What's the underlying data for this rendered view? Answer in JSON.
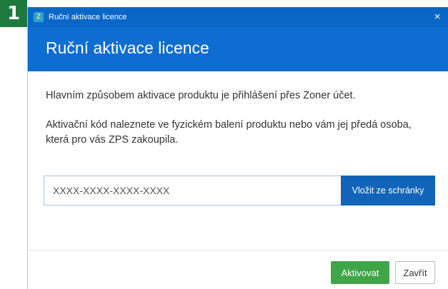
{
  "step_badge": "1",
  "window": {
    "title": "Ruční aktivace licence",
    "app_icon": "zoner-app-icon",
    "close_symbol": "×"
  },
  "header": {
    "title": "Ruční aktivace licence"
  },
  "content": {
    "paragraph1": "Hlavním způsobem aktivace produktu je přihlášení přes Zoner účet.",
    "paragraph2": "Aktivační kód naleznete ve fyzickém balení produktu nebo vám jej předá osoba, která pro vás ZPS zakoupila."
  },
  "code_input": {
    "value": "",
    "placeholder": "XXXX-XXXX-XXXX-XXXX"
  },
  "paste_button": {
    "label": "Vložit ze schránky"
  },
  "footer": {
    "activate_label": "Aktivovat",
    "close_label": "Zavřít"
  },
  "colors": {
    "titlebar": "#0a67c6",
    "header": "#0d6dd0",
    "paste_button": "#1164b8",
    "activate_button": "#3fa648",
    "step_badge": "#1e7a3c"
  }
}
